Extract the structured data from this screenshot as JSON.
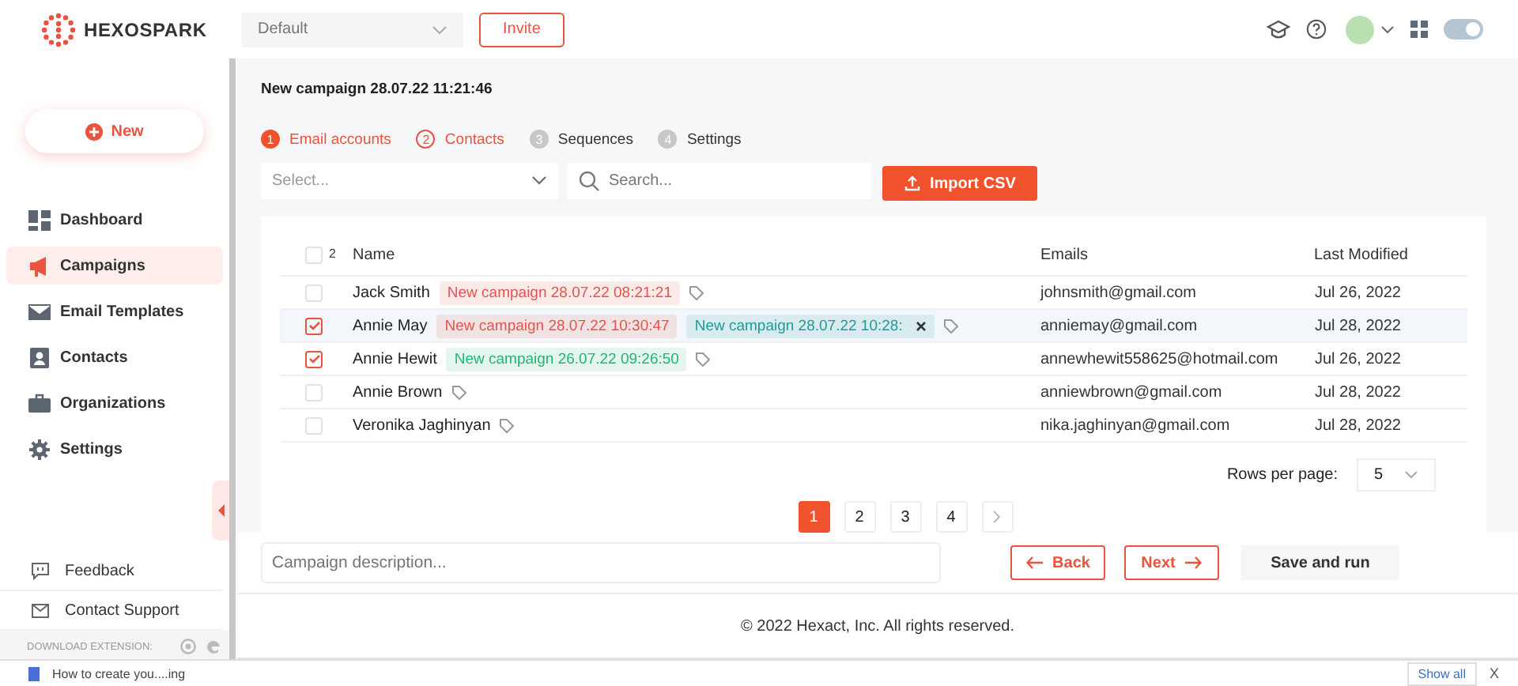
{
  "header": {
    "brand": "HEXOSPARK",
    "workspace": "Default",
    "invite": "Invite",
    "theme_toggle_on": true
  },
  "sidebar": {
    "new_button": "New",
    "items": [
      {
        "label": "Dashboard",
        "selected": false
      },
      {
        "label": "Campaigns",
        "selected": true
      },
      {
        "label": "Email Templates",
        "selected": false
      },
      {
        "label": "Contacts",
        "selected": false
      },
      {
        "label": "Organizations",
        "selected": false
      },
      {
        "label": "Settings",
        "selected": false
      }
    ],
    "bottom_links": [
      "Feedback",
      "Contact Support"
    ],
    "download_extension": "DOWNLOAD EXTENSION:"
  },
  "campaign_title": "New campaign 28.07.22 11:21:46",
  "steps": [
    {
      "number": "1",
      "label": "Email accounts",
      "kind": "done"
    },
    {
      "number": "2",
      "label": "Contacts",
      "kind": "current"
    },
    {
      "number": "3",
      "label": "Sequences",
      "kind": "pending"
    },
    {
      "number": "4",
      "label": "Settings",
      "kind": "pending"
    }
  ],
  "filters": {
    "select_placeholder": "Select...",
    "search_placeholder": "Search...",
    "import_button": "Import CSV"
  },
  "table": {
    "select_all_checked": false,
    "selected_count": "2",
    "columns": [
      "Name",
      "Emails",
      "Last Modified"
    ],
    "rows": [
      {
        "name": "Jack Smith",
        "checked": false,
        "hovered": false,
        "tags": [
          {
            "text": "New campaign 28.07.22 08:21:21",
            "color": "#e5534b",
            "removable": false
          }
        ],
        "email": "johnsmith@gmail.com",
        "modified": "Jul 26, 2022"
      },
      {
        "name": "Annie May",
        "checked": true,
        "hovered": true,
        "tags": [
          {
            "text": "New campaign 28.07.22 10:30:47",
            "color": "#e5534b",
            "removable": false
          },
          {
            "text": "New campaign 28.07.22 10:28:",
            "color": "#1e9a9a",
            "removable": true
          }
        ],
        "email": "anniemay@gmail.com",
        "modified": "Jul 28, 2022"
      },
      {
        "name": "Annie Hewit",
        "checked": true,
        "hovered": false,
        "tags": [
          {
            "text": "New campaign 26.07.22 09:26:50",
            "color": "#22b573",
            "removable": false
          }
        ],
        "email": "annewhewit558625@hotmail.com",
        "modified": "Jul 26, 2022"
      },
      {
        "name": "Annie Brown",
        "checked": false,
        "hovered": false,
        "tags": [],
        "email": "anniewbrown@gmail.com",
        "modified": "Jul 28, 2022"
      },
      {
        "name": "Veronika Jaghinyan",
        "checked": false,
        "hovered": false,
        "tags": [],
        "email": "nika.jaghinyan@gmail.com",
        "modified": "Jul 28, 2022"
      }
    ],
    "rows_per_page_label": "Rows per page:",
    "rows_per_page": "5",
    "pages": [
      {
        "label": "1",
        "selected": true
      },
      {
        "label": "2",
        "selected": false
      },
      {
        "label": "3",
        "selected": false
      },
      {
        "label": "4",
        "selected": false
      }
    ]
  },
  "actions": {
    "description_placeholder": "Campaign description...",
    "back": "Back",
    "next": "Next",
    "save": "Save and run"
  },
  "footer": "© 2022 Hexact, Inc. All rights reserved.",
  "download_bar": {
    "file": "How to create you....ing",
    "show_all": "Show all",
    "close": "X"
  }
}
